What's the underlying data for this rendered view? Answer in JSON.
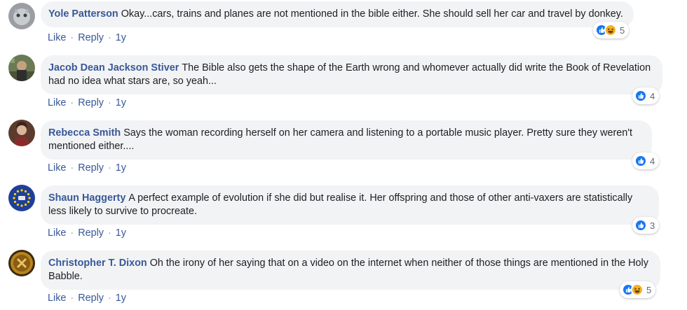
{
  "actions": {
    "like": "Like",
    "reply": "Reply",
    "separator": "·"
  },
  "colors": {
    "author_link": "#385898",
    "bubble_bg": "#f2f3f5",
    "like_blue": "#1877f2",
    "haha_yellow": "#f7b125"
  },
  "comments": [
    {
      "author": "Yole Patterson",
      "text": "Okay...cars, trains and planes are not mentioned in the bible either. She should sell her car and travel by donkey.",
      "time": "1y",
      "reactions": [
        "like-icon",
        "haha-icon"
      ],
      "reaction_count": "5"
    },
    {
      "author": "Jacob Dean Jackson Stiver",
      "text": "The Bible also gets the shape of the Earth wrong and whomever actually did write the Book of Revelation had no idea what stars are, so yeah...",
      "time": "1y",
      "reactions": [
        "like-icon"
      ],
      "reaction_count": "4"
    },
    {
      "author": "Rebecca Smith",
      "text": "Says the woman recording herself on her camera and listening to a portable music player. Pretty sure they weren't mentioned either....",
      "time": "1y",
      "reactions": [
        "like-icon"
      ],
      "reaction_count": "4"
    },
    {
      "author": "Shaun Haggerty",
      "text": "A perfect example of evolution if she did but realise it. Her offspring and those of other anti-vaxers are statistically less likely to survive to procreate.",
      "time": "1y",
      "reactions": [
        "like-icon"
      ],
      "reaction_count": "3"
    },
    {
      "author": "Christopher T. Dixon",
      "text": "Oh the irony of her saying that on a video on the internet when neither of those things are mentioned in the Holy Babble.",
      "time": "1y",
      "reactions": [
        "like-icon",
        "haha-icon"
      ],
      "reaction_count": "5"
    }
  ]
}
